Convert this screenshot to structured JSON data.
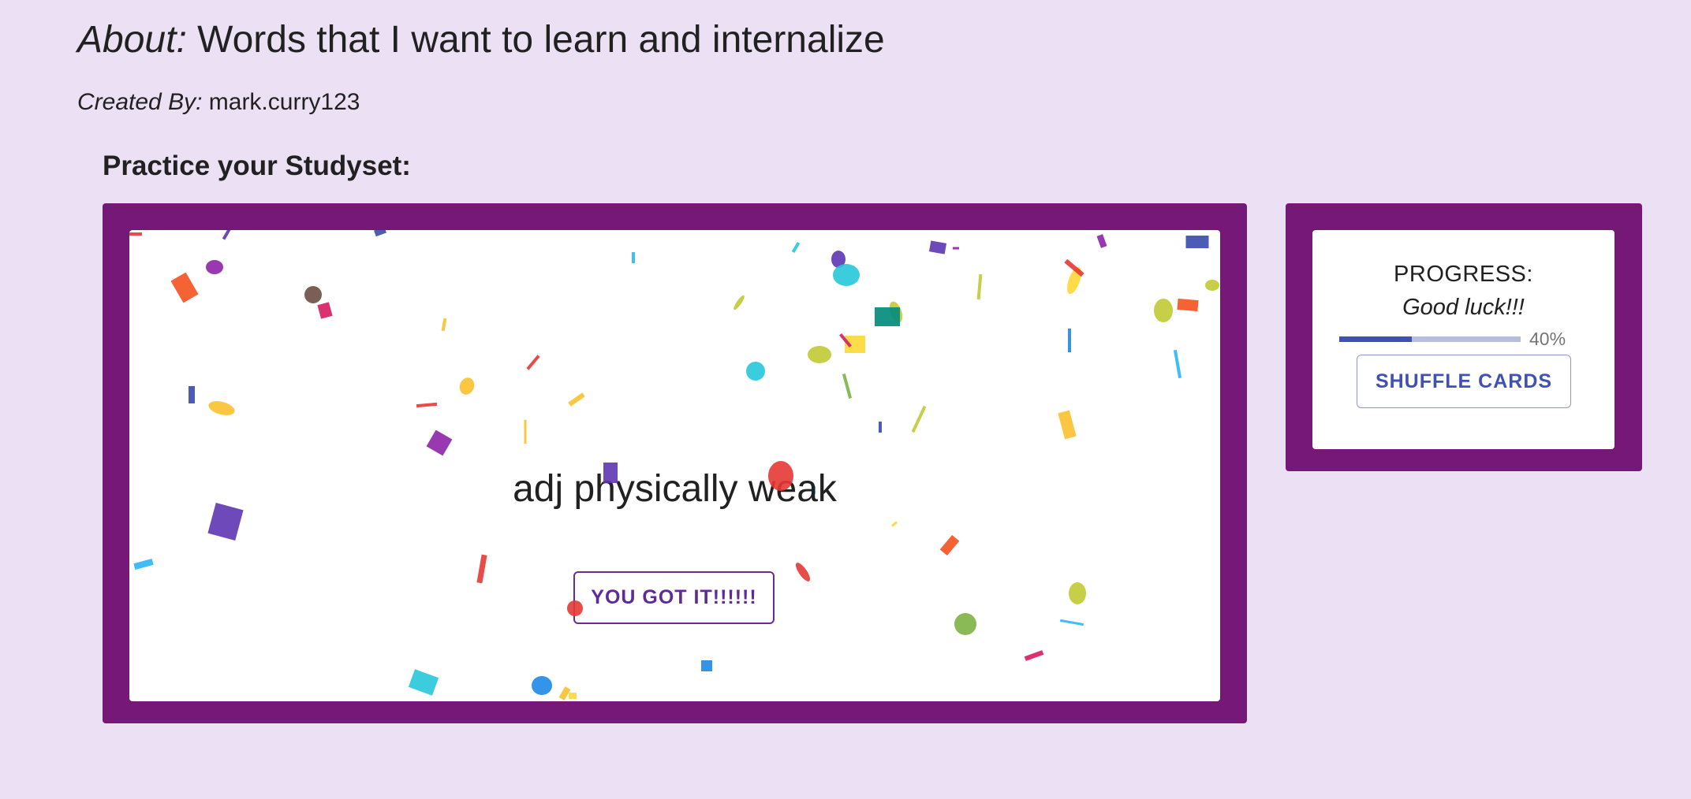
{
  "header": {
    "about_label": "About:",
    "about_text": "Words that I want to learn and internalize",
    "created_label": "Created By:",
    "created_value": "mark.curry123"
  },
  "practice": {
    "heading": "Practice your Studyset:"
  },
  "flashcard": {
    "text": "adj physically weak",
    "button_label": "YOU GOT IT!!!!!!"
  },
  "progress": {
    "title": "PROGRESS:",
    "subtitle": "Good luck!!!",
    "percent": 40,
    "percent_label": "40%",
    "shuffle_label": "SHUFFLE CARDS"
  },
  "colors": {
    "page_background": "#ebe0f4",
    "frame": "#761878",
    "accent_indigo": "#3f51b5",
    "button_purple": "#5e2b97",
    "confetti_palette": [
      "#e53935",
      "#f4511e",
      "#fbc02d",
      "#fdd835",
      "#c0ca33",
      "#7cb342",
      "#26c6da",
      "#29b6f6",
      "#1e88e5",
      "#3949ab",
      "#5e35b1",
      "#8e24aa",
      "#d81b60",
      "#00897b",
      "#6d4c41"
    ]
  }
}
